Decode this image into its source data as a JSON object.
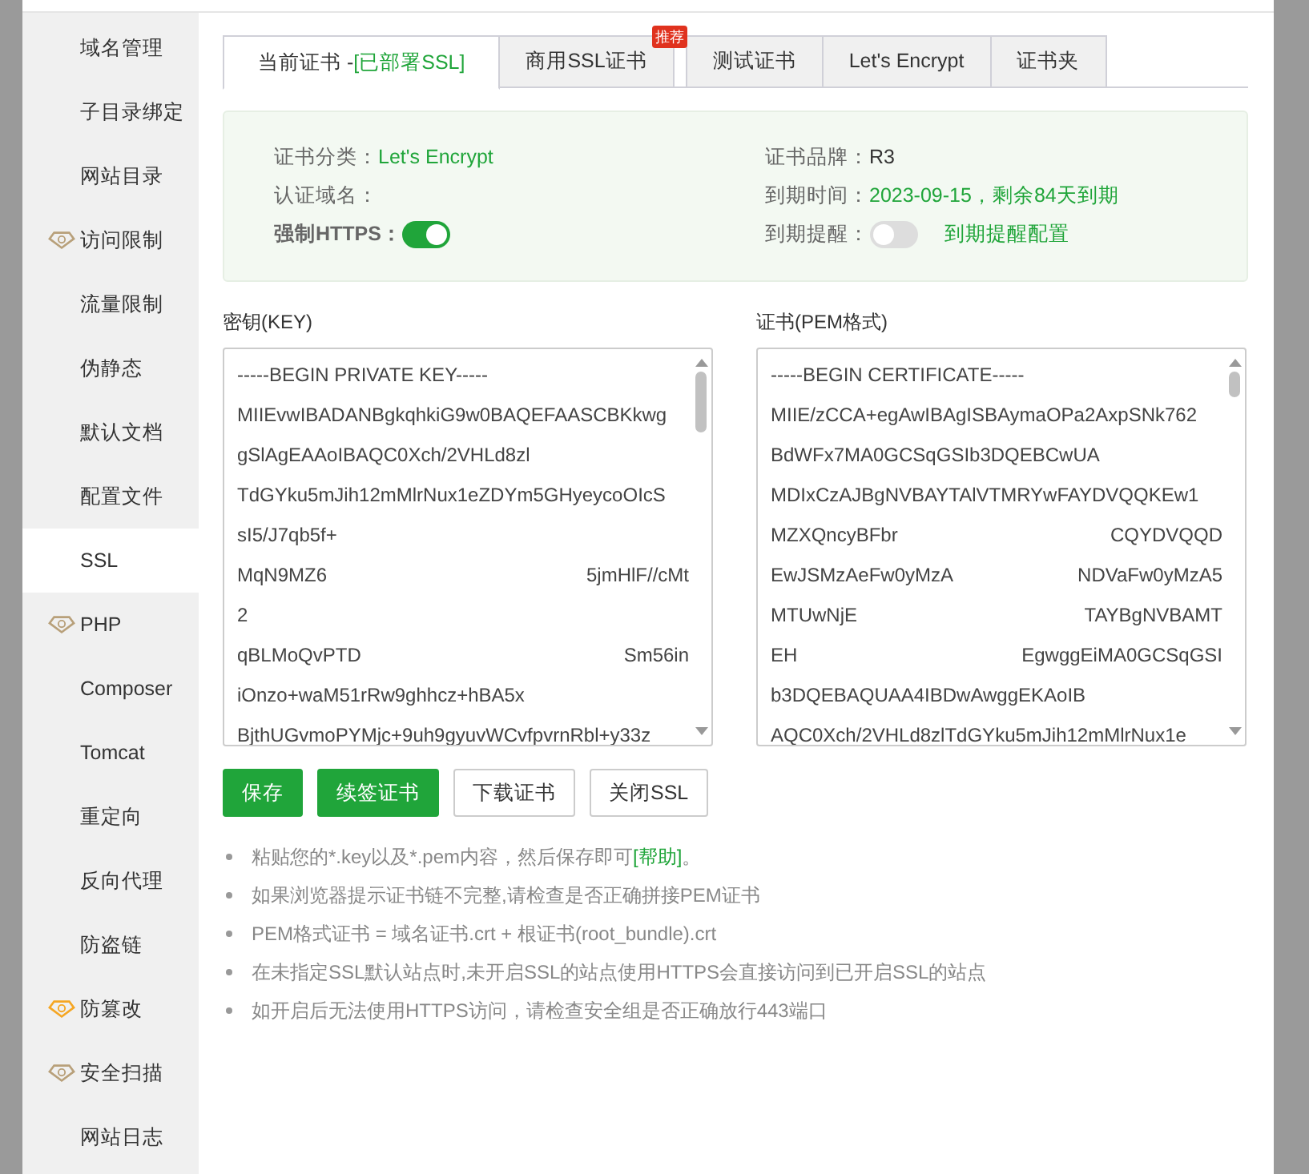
{
  "sidebar": {
    "items": [
      {
        "label": "域名管理",
        "selected": false
      },
      {
        "label": "子目录绑定",
        "selected": false
      },
      {
        "label": "网站目录",
        "selected": false
      },
      {
        "label": "访问限制",
        "selected": false,
        "color": "#b8a07a"
      },
      {
        "label": "流量限制",
        "selected": false
      },
      {
        "label": "伪静态",
        "selected": false
      },
      {
        "label": "默认文档",
        "selected": false
      },
      {
        "label": "配置文件",
        "selected": false
      },
      {
        "label": "SSL",
        "selected": true
      },
      {
        "label": "PHP",
        "selected": false,
        "color": "#b8a07a"
      },
      {
        "label": "Composer",
        "selected": false
      },
      {
        "label": "Tomcat",
        "selected": false
      },
      {
        "label": "重定向",
        "selected": false
      },
      {
        "label": "反向代理",
        "selected": false
      },
      {
        "label": "防盗链",
        "selected": false
      },
      {
        "label": "防篡改",
        "selected": false,
        "color": "#f5a623"
      },
      {
        "label": "安全扫描",
        "selected": false,
        "color": "#b8a07a"
      },
      {
        "label": "网站日志",
        "selected": false
      }
    ]
  },
  "tabs": [
    {
      "label": "当前证书 - ",
      "status": "[已部署SSL]",
      "selected": true
    },
    {
      "label": "商用SSL证书",
      "ribbon": "推荐",
      "selected": false
    },
    {
      "label": "测试证书",
      "selected": false
    },
    {
      "label": "Let's Encrypt",
      "selected": false
    },
    {
      "label": "证书夹",
      "selected": false
    }
  ],
  "info": [
    {
      "kind": "text",
      "label": "证书分类：",
      "value": "Let's Encrypt",
      "highlight": true
    },
    {
      "kind": "text",
      "label": "证书品牌：",
      "value": "R3",
      "highlight": false
    },
    {
      "kind": "text",
      "label": "认证域名："
    },
    {
      "kind": "text",
      "label": "到期时间：",
      "value": "2023-09-15，剩余84天到期",
      "highlight": true
    },
    {
      "kind": "toggle",
      "label": "强制HTTPS：",
      "on": true,
      "strong": true
    },
    {
      "kind": "toggle",
      "label": "到期提醒：",
      "on": false,
      "link": "到期提醒配置"
    }
  ],
  "key": {
    "label": "密钥(KEY)",
    "lines": [
      [
        "-----BEGIN PRIVATE KEY-----"
      ],
      [
        "MIIEvwIBADANBgkqhkiG9w0BAQEFAASCBKkwg"
      ],
      [
        "gSlAgEAAoIBAQC0Xch/2VHLd8zl"
      ],
      [
        "TdGYku5mJih12mMlrNux1eZDYm5GHyeycoOIcS"
      ],
      [
        "sI5/J7qb5f+"
      ],
      [
        "MqN9MZ6",
        "5jmHlF//cMt"
      ],
      [
        "2"
      ],
      [
        "qBLMoQvPTD",
        "Sm56in"
      ],
      [
        "iOnzo+waM51rRw9ghhcz+hBA5x"
      ],
      [
        "BjthUGvmoPYMjc+9uh9gyuvWCvfpvrnRbl+y33z"
      ]
    ]
  },
  "cert": {
    "label": "证书(PEM格式)",
    "lines": [
      [
        "-----BEGIN CERTIFICATE-----"
      ],
      [
        "MIIE/zCCA+egAwIBAgISBAymaOPa2AxpSNk762"
      ],
      [
        "BdWFx7MA0GCSqGSIb3DQEBCwUA"
      ],
      [
        "MDIxCzAJBgNVBAYTAlVTMRYwFAYDVQQKEw1"
      ],
      [
        "MZXQncyBFbr",
        "CQYDVQQD"
      ],
      [
        "EwJSMzAeFw0yMzA",
        "NDVaFw0yMzA5"
      ],
      [
        "MTUwNjE",
        "TAYBgNVBAMT"
      ],
      [
        "EH",
        "EgwggEiMA0GCSqGSI"
      ],
      [
        "b3DQEBAQUAA4IBDwAwggEKAoIB"
      ],
      [
        "AQC0Xch/2VHLd8zlTdGYku5mJih12mMlrNux1e"
      ]
    ]
  },
  "buttons": [
    {
      "label": "保存",
      "kind": "primary"
    },
    {
      "label": "续签证书",
      "kind": "primary"
    },
    {
      "label": "下载证书",
      "kind": "default"
    },
    {
      "label": "关闭SSL",
      "kind": "default"
    }
  ],
  "notes": [
    {
      "text": "粘贴您的*.key以及*.pem内容，然后保存即可",
      "link": "[帮助]",
      "after": "。"
    },
    {
      "text": "如果浏览器提示证书链不完整,请检查是否正确拼接PEM证书"
    },
    {
      "text": "PEM格式证书 = 域名证书.crt + 根证书(root_bundle).crt"
    },
    {
      "text": "在未指定SSL默认站点时,未开启SSL的站点使用HTTPS会直接访问到已开启SSL的站点"
    },
    {
      "text": "如开启后无法使用HTTPS访问，请检查安全组是否正确放行443端口"
    }
  ]
}
